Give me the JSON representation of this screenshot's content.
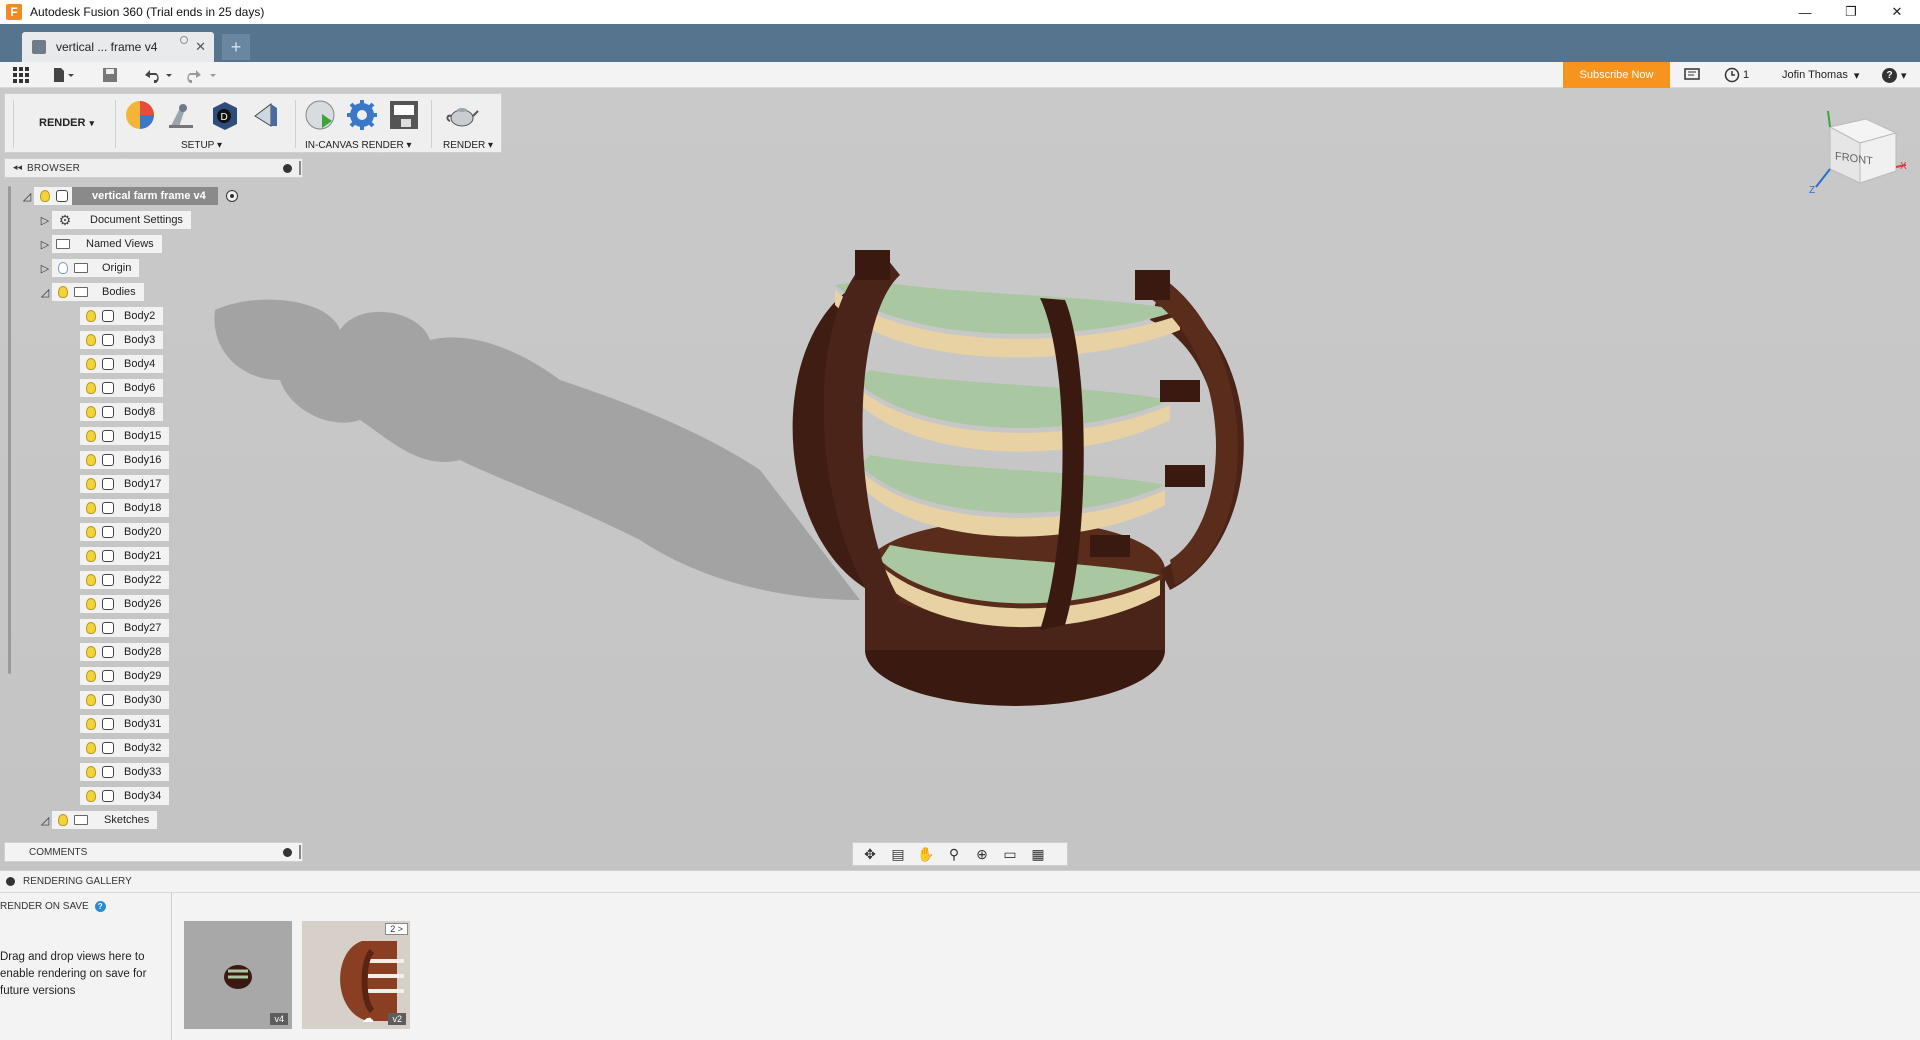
{
  "window": {
    "title": "Autodesk Fusion 360 (Trial ends in 25 days)",
    "controls": {
      "minimize": "—",
      "maximize": "❐",
      "close": "✕"
    }
  },
  "tabs": [
    {
      "label": "vertical ... frame v4",
      "close": "✕"
    }
  ],
  "new_tab": "+",
  "quick_access": {
    "subscribe": "Subscribe Now",
    "jobs_count": "1",
    "user": "Jofin Thomas",
    "help": "?"
  },
  "toolbar": {
    "workspace": "RENDER",
    "groups": [
      {
        "label": "SETUP"
      },
      {
        "label": "IN-CANVAS RENDER"
      },
      {
        "label": "RENDER"
      }
    ],
    "icons": [
      "appearance-icon",
      "scene-settings-icon",
      "decal-icon",
      "texture-map-icon",
      "in-canvas-render-icon",
      "render-settings-icon",
      "capture-image-icon",
      "render-teapot-icon"
    ]
  },
  "browser": {
    "title": "BROWSER",
    "root": "vertical farm frame v4",
    "folders": [
      {
        "label": "Document Settings"
      },
      {
        "label": "Named Views"
      },
      {
        "label": "Origin"
      },
      {
        "label": "Bodies"
      }
    ],
    "bodies": [
      "Body2",
      "Body3",
      "Body4",
      "Body6",
      "Body8",
      "Body15",
      "Body16",
      "Body17",
      "Body18",
      "Body20",
      "Body21",
      "Body22",
      "Body26",
      "Body27",
      "Body28",
      "Body29",
      "Body30",
      "Body31",
      "Body32",
      "Body33",
      "Body34"
    ],
    "sketches": "Sketches"
  },
  "comments": {
    "title": "COMMENTS"
  },
  "viewcube": {
    "face": "FRONT",
    "axis_x": "X",
    "axis_z": "Z"
  },
  "gallery": {
    "title": "RENDERING GALLERY",
    "render_on_save": "RENDER ON SAVE",
    "help": "?",
    "hint": "Drag and drop views here to enable rendering on save for future versions",
    "thumbs": [
      {
        "version": "v4"
      },
      {
        "version": "v2",
        "count": "2 >"
      }
    ]
  },
  "colors": {
    "tabbar": "#57748f",
    "subscribe": "#f7941d",
    "wood": "#4a2418",
    "tray": "#a9c7a0",
    "tray_rim": "#e8d2a4"
  }
}
